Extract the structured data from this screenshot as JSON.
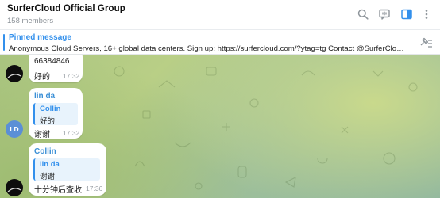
{
  "header": {
    "title": "SurferCloud Official Group",
    "members": "158 members"
  },
  "pinned": {
    "title": "Pinned message",
    "text": "Anonymous Cloud Servers, 16+ global data centers. Sign up: https://surfercloud.com/?ytag=tg Contact @SurferCloudC..."
  },
  "messages": [
    {
      "top_text": "66384846",
      "text": "好的",
      "time": "17:32"
    },
    {
      "sender": "lin da",
      "quote": {
        "name": "Collin",
        "text": "好的"
      },
      "text": "谢谢",
      "time": "17:32",
      "avatar_initials": "LD"
    },
    {
      "sender": "Collin",
      "quote": {
        "name": "lin da",
        "text": "谢谢"
      },
      "text": "十分钟后查收",
      "time": "17:36"
    }
  ],
  "colors": {
    "accent": "#3390ec",
    "wallpaper": "#a9c480"
  },
  "icons": [
    "search-icon",
    "video-chat-icon",
    "sidebar-icon",
    "more-icon",
    "pin-list-icon"
  ]
}
